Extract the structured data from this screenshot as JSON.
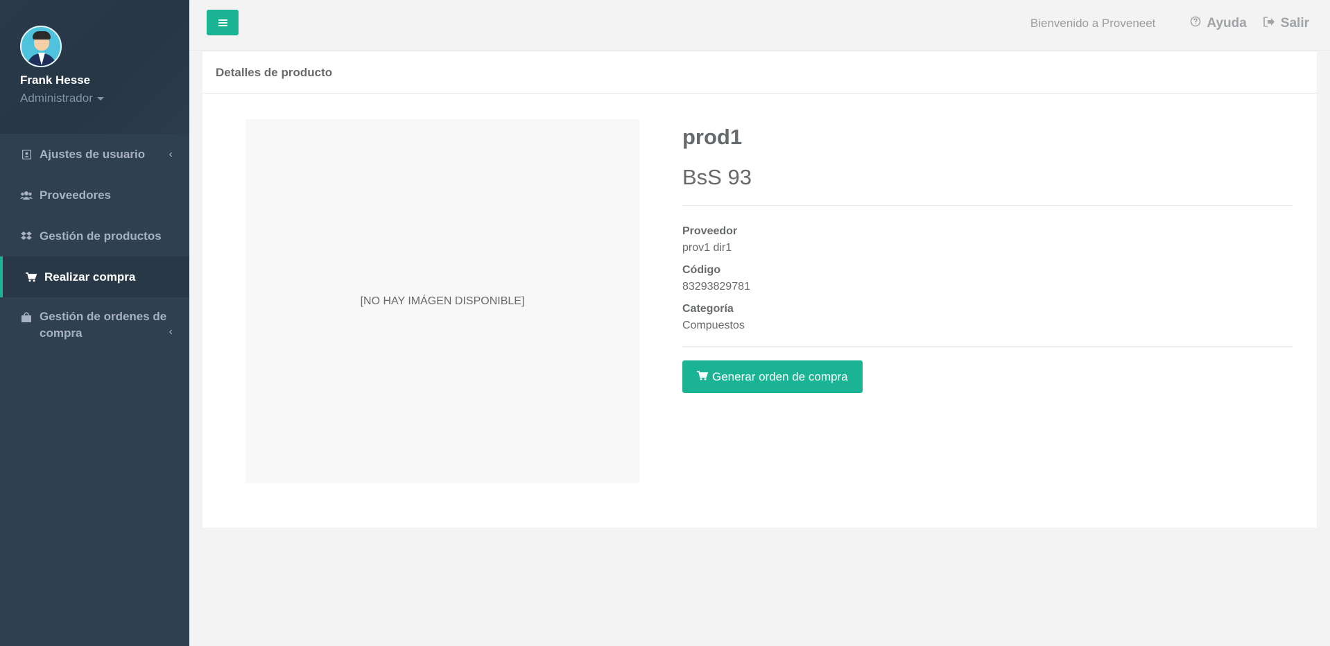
{
  "user": {
    "name": "Frank Hesse",
    "role": "Administrador"
  },
  "sidebar": {
    "items": [
      {
        "label": "Ajustes de usuario",
        "icon": "user-card-icon",
        "has_submenu": true
      },
      {
        "label": "Proveedores",
        "icon": "users-icon",
        "has_submenu": false
      },
      {
        "label": "Gestión de productos",
        "icon": "dropbox-icon",
        "has_submenu": false
      },
      {
        "label": "Realizar compra",
        "icon": "shopping-cart-icon",
        "has_submenu": false,
        "active": true
      },
      {
        "label": "Gestión de ordenes de compra",
        "icon": "shopping-bag-icon",
        "has_submenu": true
      }
    ]
  },
  "topbar": {
    "welcome": "Bienvenido a Proveneet",
    "help": "Ayuda",
    "logout": "Salir"
  },
  "panel": {
    "title": "Detalles de producto"
  },
  "product": {
    "image_placeholder": "[NO HAY IMÁGEN DISPONIBLE]",
    "name": "prod1",
    "price": "BsS 93",
    "supplier_label": "Proveedor",
    "supplier_value": "prov1 dir1",
    "code_label": "Código",
    "code_value": "83293829781",
    "category_label": "Categoría",
    "category_value": "Compuestos",
    "order_button": "Generar orden de compra"
  },
  "colors": {
    "accent": "#1ab394",
    "sidebar": "#2f4050",
    "sidebar_active": "#293846"
  }
}
